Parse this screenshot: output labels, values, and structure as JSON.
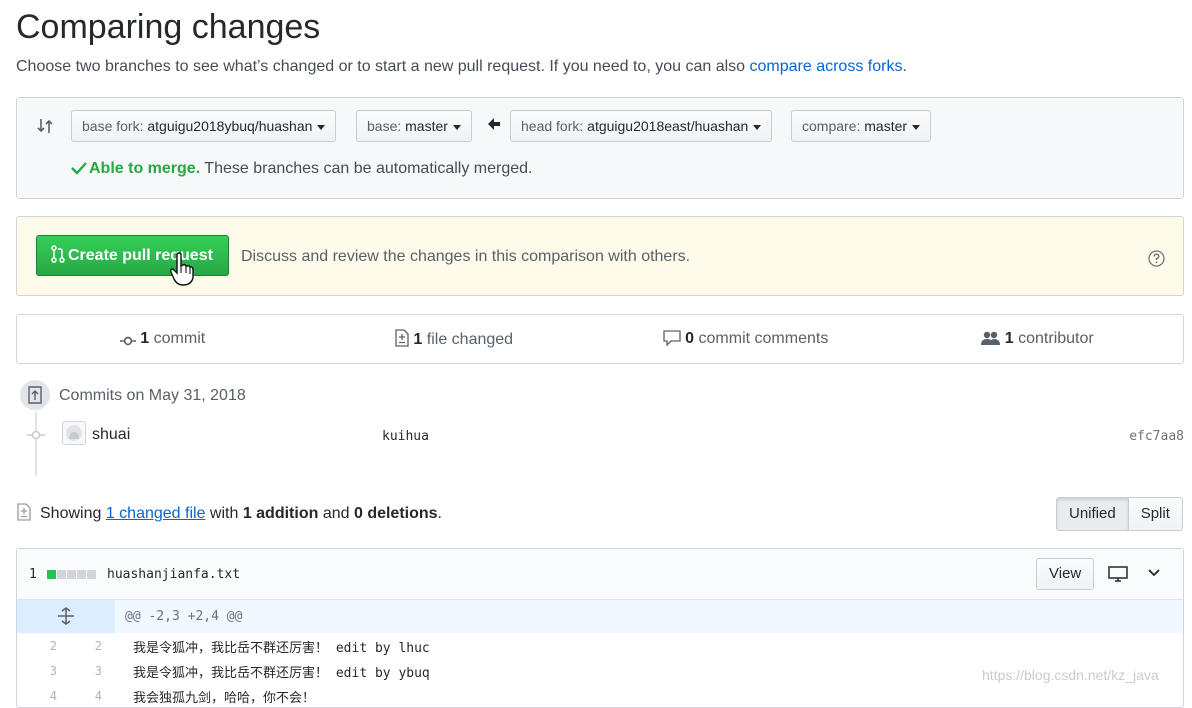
{
  "page": {
    "title": "Comparing changes",
    "subtitle": "Choose two branches to see what’s changed or to start a new pull request. If you need to, you can also",
    "subtitle_link": "compare across forks",
    "subtitle_end": "."
  },
  "range": {
    "base_fork_prefix": "base fork: ",
    "base_fork_value": "atguigu2018ybuq/huashan",
    "base_prefix": "base: ",
    "base_value": "master",
    "head_fork_prefix": "head fork: ",
    "head_fork_value": "atguigu2018east/huashan",
    "compare_prefix": "compare: ",
    "compare_value": "master",
    "merge_ok": "Able to merge.",
    "merge_text": " These branches can be automatically merged."
  },
  "pr": {
    "button_label": "Create pull request",
    "description": "Discuss and review the changes in this comparison with others."
  },
  "summary": {
    "commits_count": "1",
    "commits_label": " commit",
    "files_count": "1",
    "files_label": " file changed",
    "comments_count": "0",
    "comments_label": " commit comments",
    "contributors_count": "1",
    "contributors_label": " contributor"
  },
  "commits": {
    "date_label": "Commits on May 31, 2018",
    "items": [
      {
        "author": "shuai",
        "message": "kuihua",
        "sha": "efc7aa8"
      }
    ]
  },
  "diff_toolbar": {
    "showing": "Showing ",
    "changed_link": "1 changed file",
    "with": " with ",
    "additions": "1 addition",
    "and": " and ",
    "deletions": "0 deletions",
    "end": ".",
    "unified_label": "Unified",
    "split_label": "Split"
  },
  "file": {
    "changes_count": "1",
    "name": "huashanjianfa.txt",
    "view_label": "View",
    "hunk_header": "@@ -2,3 +2,4 @@",
    "lines": [
      {
        "old": "2",
        "new": "2",
        "text_cn": "我是令狐冲，我比岳不群还厉害！",
        "text_en": "edit by lhuc"
      },
      {
        "old": "3",
        "new": "3",
        "text_cn": "我是令狐冲，我比岳不群还厉害！",
        "text_en": "edit by ybuq"
      },
      {
        "old": "4",
        "new": "4",
        "text_cn": "我会独孤九剑，哈哈，你不会！",
        "text_en": ""
      }
    ]
  },
  "watermark": "https://blog.csdn.net/kz_java",
  "colors": {
    "accent_green": "#28a745",
    "link_blue": "#0366d6",
    "pr_box_bg": "#fffbeb"
  }
}
